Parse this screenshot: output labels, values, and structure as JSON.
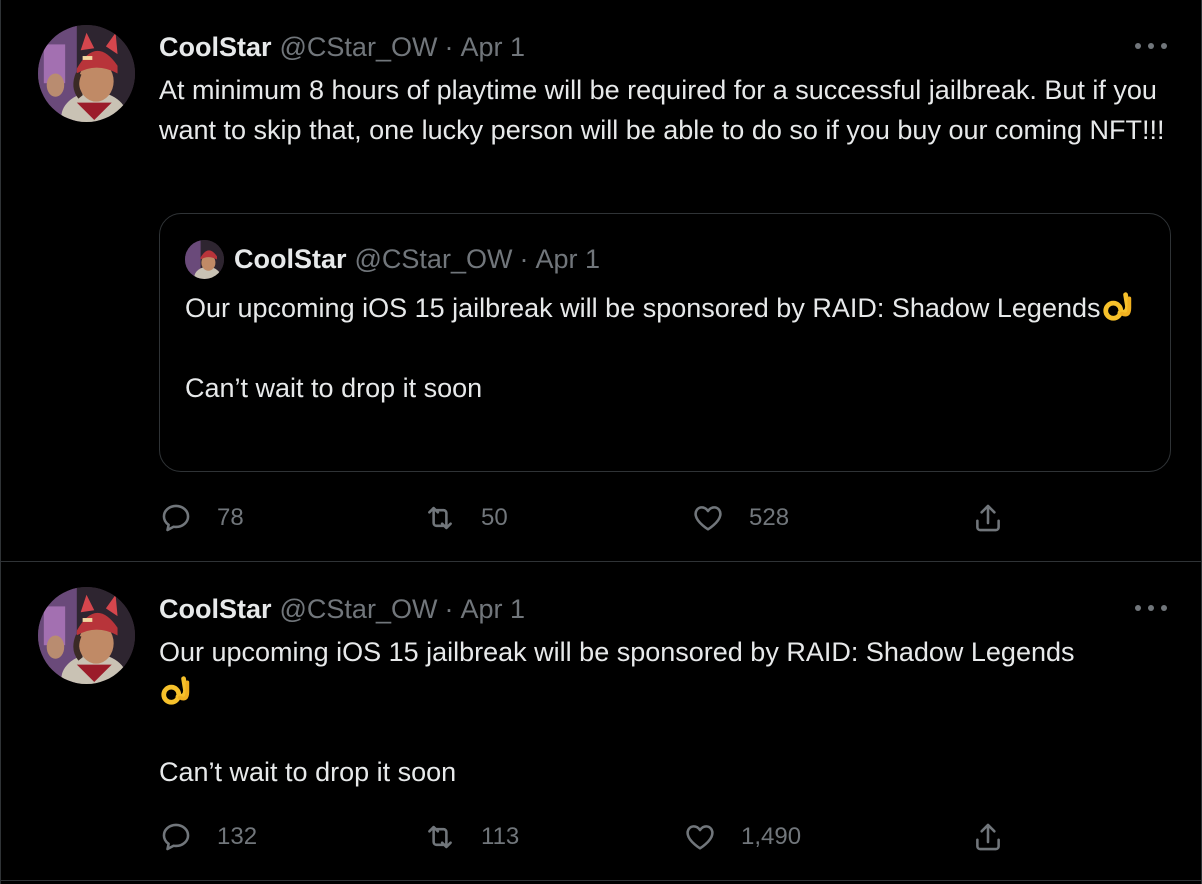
{
  "tweets": [
    {
      "author_name": "CoolStar",
      "author_handle": "@CStar_OW",
      "separator": "·",
      "date": "Apr 1",
      "text": "At minimum 8 hours of playtime will be required for a successful jailbreak. But if you want to skip that, one lucky person will be able to do so if you buy our coming NFT!!!",
      "quoted": {
        "author_name": "CoolStar",
        "author_handle": "@CStar_OW",
        "separator": "·",
        "date": "Apr 1",
        "text_line1": "Our upcoming iOS 15 jailbreak will be sponsored by RAID: Shadow Legends",
        "text_line2": "Can’t wait to drop it soon",
        "emoji": "ok-hand-emoji"
      },
      "replies": "78",
      "retweets": "50",
      "likes": "528"
    },
    {
      "author_name": "CoolStar",
      "author_handle": "@CStar_OW",
      "separator": "·",
      "date": "Apr 1",
      "text_line1": "Our upcoming iOS 15 jailbreak will be sponsored by RAID: Shadow Legends",
      "text_line2": "Can’t wait to drop it soon",
      "emoji": "ok-hand-emoji",
      "replies": "132",
      "retweets": "113",
      "likes": "1,490"
    }
  ],
  "colors": {
    "background": "#000000",
    "text_primary": "#e7e9ea",
    "text_secondary": "#71767b",
    "border": "#2f3336"
  }
}
